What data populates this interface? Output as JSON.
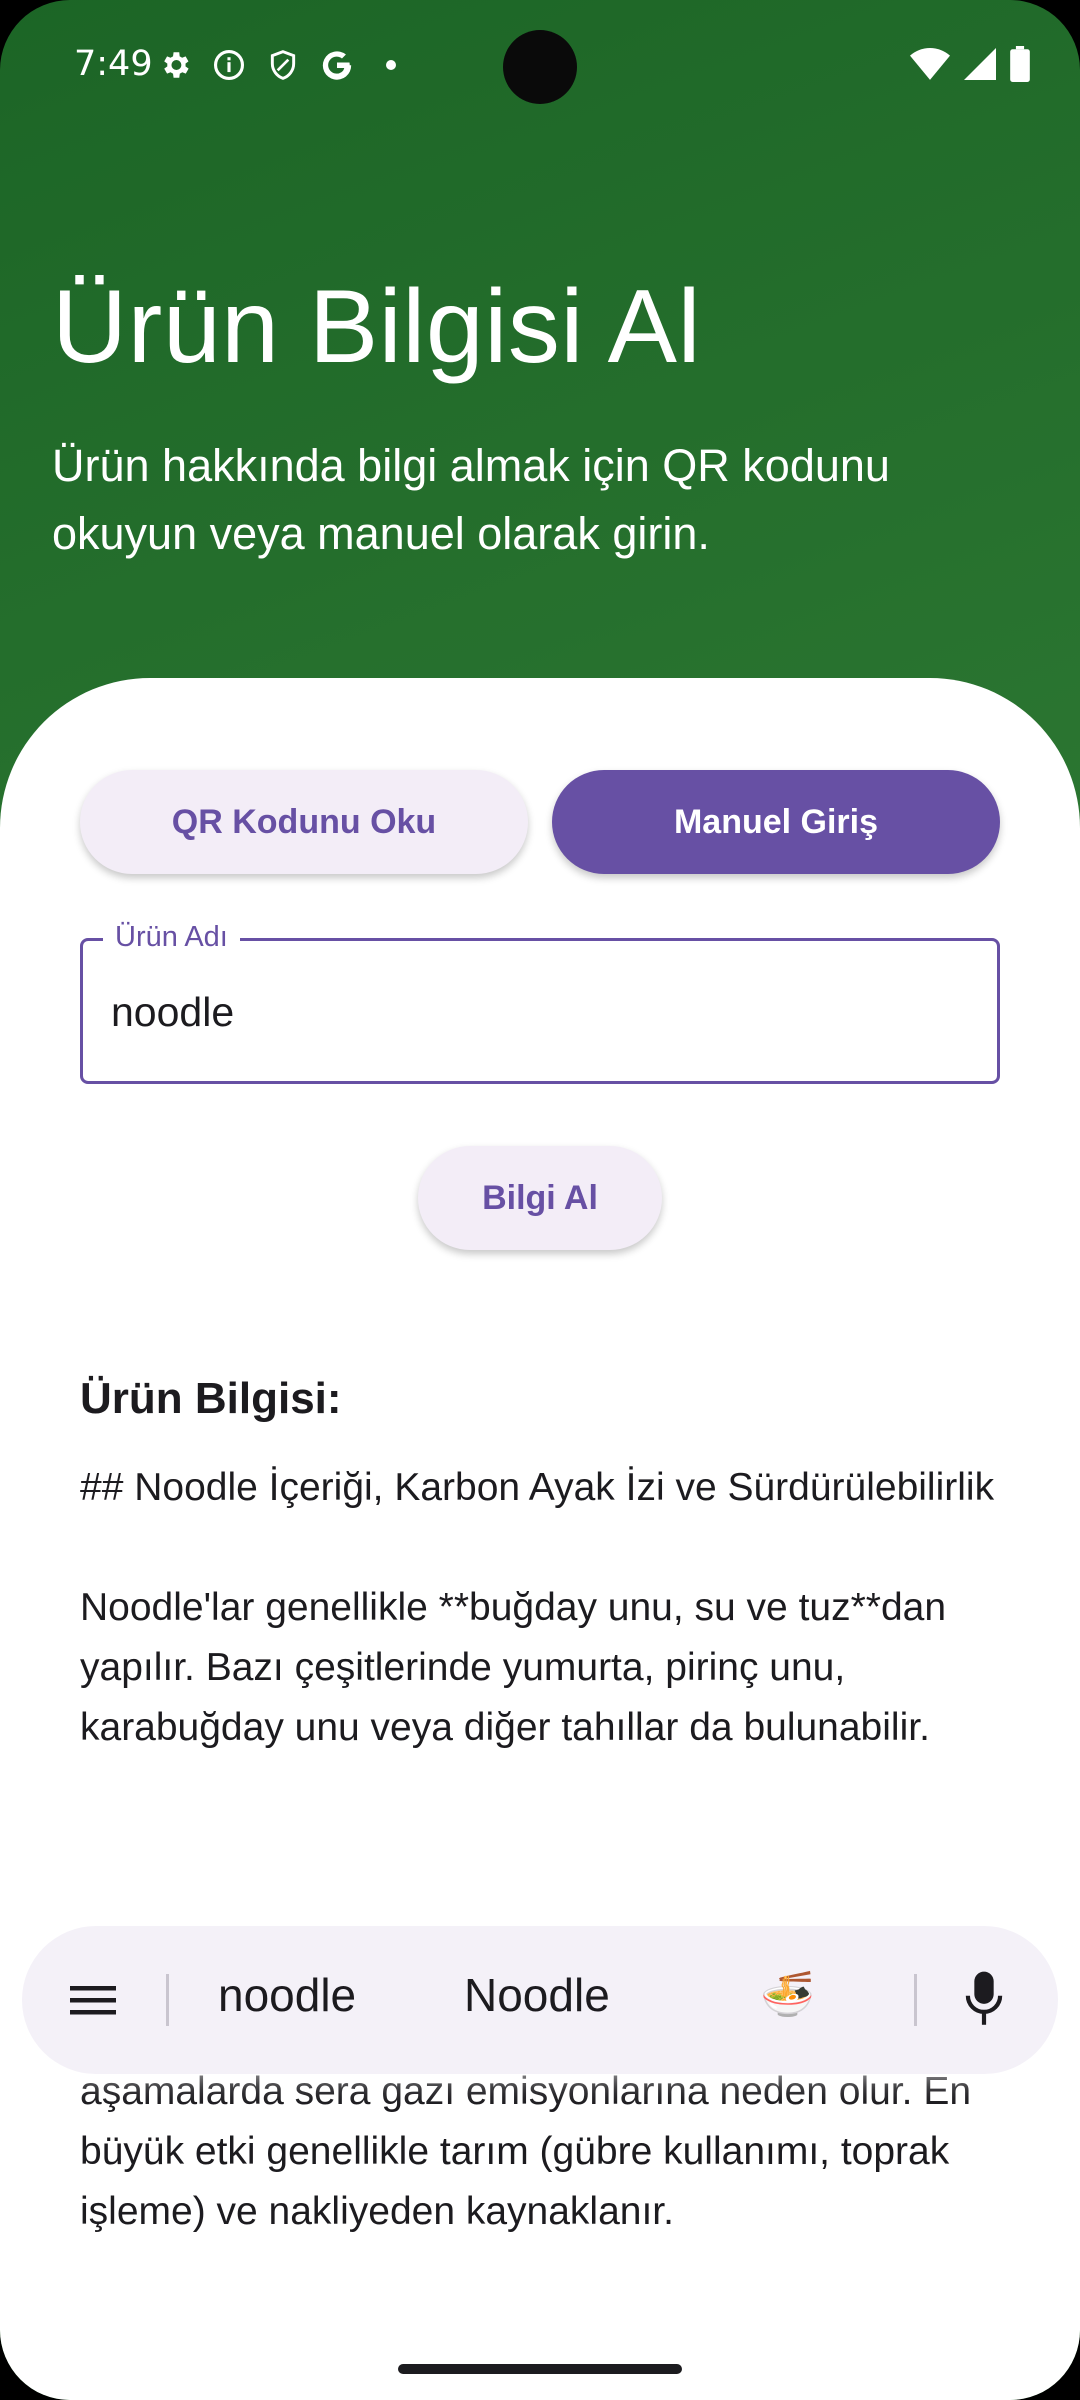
{
  "status_bar": {
    "time": "7:49",
    "left_icons": [
      "gear-icon",
      "info-icon",
      "shield-icon",
      "google-icon",
      "dot-icon"
    ],
    "right_icons": [
      "wifi-icon",
      "signal-icon",
      "battery-icon"
    ]
  },
  "header": {
    "title": "Ürün Bilgisi Al",
    "subtitle": "Ürün hakkında bilgi almak için QR kodunu okuyun veya manuel olarak girin."
  },
  "mode_toggle": {
    "qr_label": "QR Kodunu Oku",
    "manual_label": "Manuel Giriş",
    "selected": "Manuel Giriş"
  },
  "product_field": {
    "label": "Ürün Adı",
    "value": "noodle"
  },
  "get_info_button": {
    "label": "Bilgi Al"
  },
  "result": {
    "heading": "Ürün Bilgisi:",
    "paragraph_1": "## Noodle İçeriği, Karbon Ayak İzi ve Sürdürülebilirlik",
    "paragraph_2": "Noodle'lar genellikle **buğday unu, su ve tuz**dan yapılır. Bazı çeşitlerinde yumurta, pirinç unu, karabuğday unu veya diğer tahıllar da bulunabilir.",
    "paragraph_3": "aşamalarda sera gazı emisyonlarına neden olur. En büyük etki genellikle tarım (gübre kullanımı, toprak işleme) ve nakliyeden kaynaklanır."
  },
  "keyboard_suggestions": {
    "items": [
      "noodle",
      "Noodle",
      "🍜"
    ]
  },
  "colors": {
    "primary": "#6750a4",
    "header_green": "#2f7a34",
    "tonal_button": "#f3edf7"
  }
}
